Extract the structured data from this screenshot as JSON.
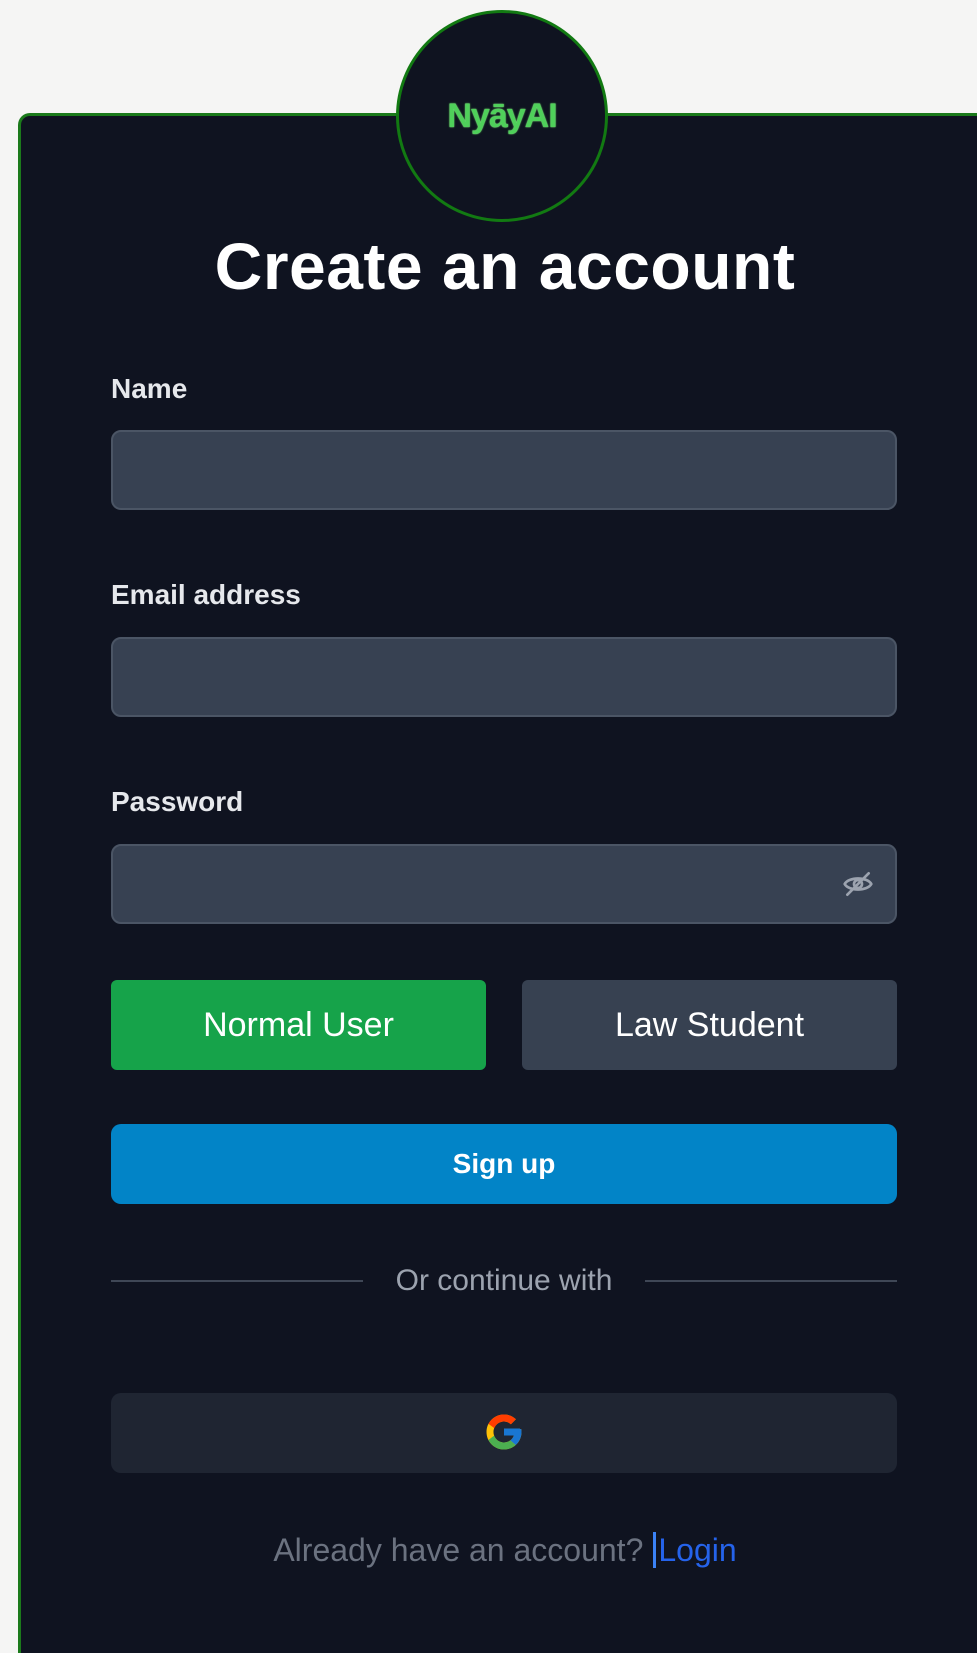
{
  "brand": {
    "logo_text": "NyāyAI"
  },
  "title": "Create an account",
  "form": {
    "name_label": "Name",
    "name_value": "",
    "email_label": "Email address",
    "email_value": "",
    "password_label": "Password",
    "password_value": ""
  },
  "roles": {
    "normal_label": "Normal User",
    "student_label": "Law Student",
    "selected": "Normal User"
  },
  "signup_label": "Sign up",
  "divider_text": "Or continue with",
  "social": {
    "google_icon": "google-icon"
  },
  "footer": {
    "prompt": "Already have an account?",
    "login_label": "Login"
  },
  "colors": {
    "card_bg": "#0f1320",
    "card_border": "#1b7a1b",
    "input_bg": "#374152",
    "normal_user_bg": "#16a34a",
    "law_student_bg": "#374151",
    "signup_bg": "#0284c7",
    "google_bg": "#1f2532",
    "login_link": "#2563eb",
    "logo_text": "#4fd05a"
  },
  "icons": {
    "password_toggle": "eye-off-icon"
  }
}
